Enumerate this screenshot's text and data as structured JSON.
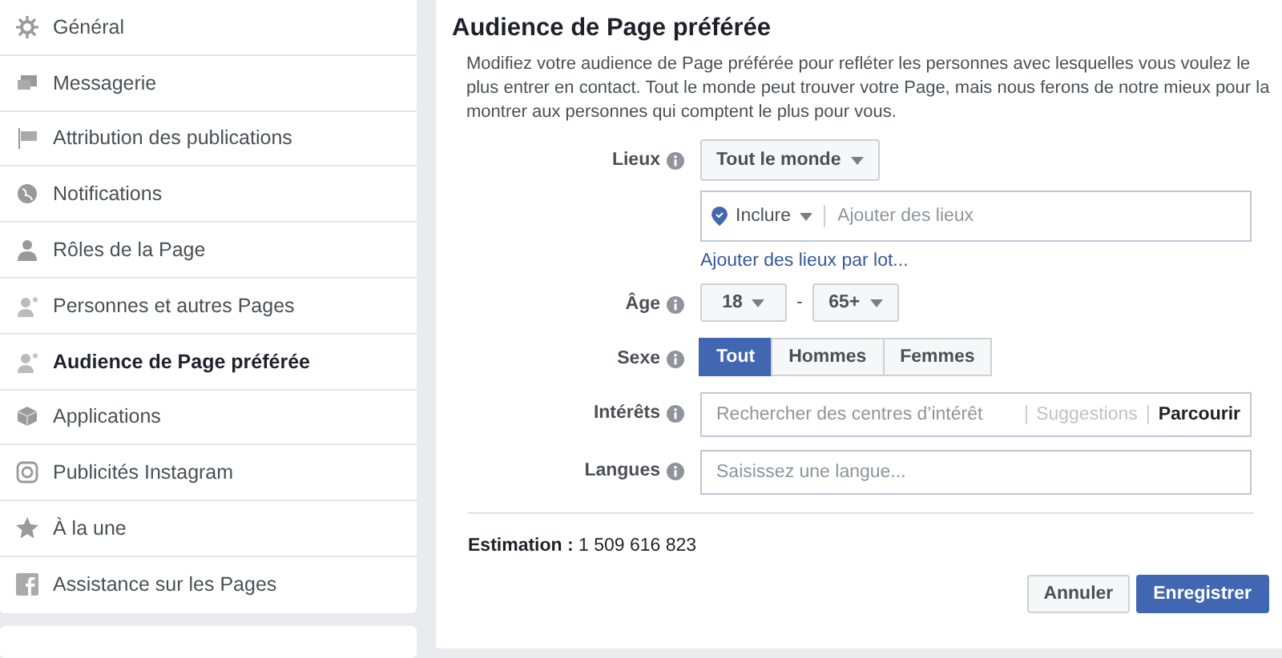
{
  "sidebar": {
    "items": [
      {
        "label": "Général",
        "selected": false
      },
      {
        "label": "Messagerie",
        "selected": false
      },
      {
        "label": "Attribution des publications",
        "selected": false
      },
      {
        "label": "Notifications",
        "selected": false
      },
      {
        "label": "Rôles de la Page",
        "selected": false
      },
      {
        "label": "Personnes et autres Pages",
        "selected": false
      },
      {
        "label": "Audience de Page préférée",
        "selected": true
      },
      {
        "label": "Applications",
        "selected": false
      },
      {
        "label": "Publicités Instagram",
        "selected": false
      },
      {
        "label": "À la une",
        "selected": false
      },
      {
        "label": "Assistance sur les Pages",
        "selected": false
      }
    ]
  },
  "panel": {
    "title": "Audience de Page préférée",
    "description": "Modifiez votre audience de Page préférée pour refléter les personnes avec lesquelles vous voulez le plus entrer en contact. Tout le monde peut trouver votre Page, mais nous ferons de notre mieux pour la montrer aux personnes qui comptent le plus pour vous.",
    "locations": {
      "label": "Lieux",
      "scope": "Tout le monde",
      "mode": "Inclure",
      "placeholder": "Ajouter des lieux",
      "bulk_link": "Ajouter des lieux par lot..."
    },
    "age": {
      "label": "Âge",
      "min": "18",
      "separator": "-",
      "max": "65+"
    },
    "gender": {
      "label": "Sexe",
      "options": [
        {
          "label": "Tout",
          "selected": true
        },
        {
          "label": "Hommes",
          "selected": false
        },
        {
          "label": "Femmes",
          "selected": false
        }
      ]
    },
    "interests": {
      "label": "Intérêts",
      "placeholder": "Rechercher des centres d’intérêt",
      "suggestions": "Suggestions",
      "browse": "Parcourir"
    },
    "languages": {
      "label": "Langues",
      "placeholder": "Saisissez une langue..."
    },
    "estimate": "**Estimation :** 1 509 616 823",
    "buttons": [
      {
        "label": "Annuler",
        "kind": "secondary"
      },
      {
        "label": "Enregistrer",
        "kind": "primary"
      }
    ]
  }
}
